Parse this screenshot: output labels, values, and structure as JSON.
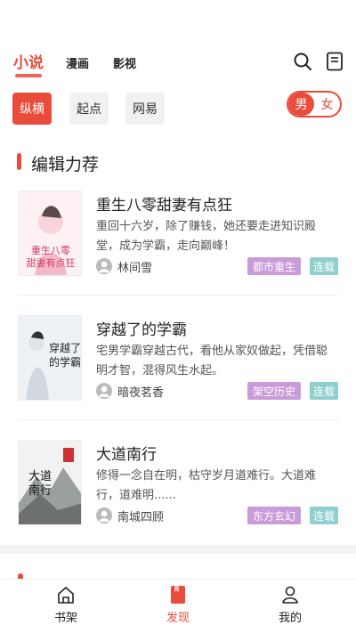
{
  "topnav": {
    "tabs": [
      {
        "label": "小说"
      },
      {
        "label": "漫画"
      },
      {
        "label": "影视"
      }
    ],
    "icons": [
      "search-icon",
      "bookshelf-icon"
    ]
  },
  "filters": {
    "channels": [
      "纵横",
      "起点",
      "网易"
    ],
    "gender": {
      "male": "男",
      "female": "女",
      "selected": "男"
    }
  },
  "section": {
    "title": "编辑力荐"
  },
  "books": [
    {
      "title": "重生八零甜妻有点狂",
      "desc": "重回十六岁，除了赚钱，她还要走进知识殿堂，成为学霸，走向巅峰！",
      "author": "林间雪",
      "genre": "都市重生",
      "status": "连载",
      "cover_text": "重生八零甜妻有点狂"
    },
    {
      "title": "穿越了的学霸",
      "desc": "宅男学霸穿越古代，看他从家奴做起，凭借聪明才智，混得风生水起。",
      "author": "暗夜茗香",
      "genre": "架空历史",
      "status": "连载",
      "cover_text": "穿越了的学霸"
    },
    {
      "title": "大道南行",
      "desc": "修得一念自在明，枯守岁月道难行。大道难行，道难明......",
      "author": "南城四顾",
      "genre": "东方玄幻",
      "status": "连载",
      "cover_text": "大道南行"
    }
  ],
  "bottomnav": [
    {
      "label": "书架",
      "icon": "home-icon"
    },
    {
      "label": "发现",
      "icon": "discover-icon",
      "active": true
    },
    {
      "label": "我的",
      "icon": "user-icon"
    }
  ],
  "colors": {
    "accent": "#e94c3b",
    "genre_tag": "#c99bd9",
    "status_tag": "#8fd0cf"
  }
}
